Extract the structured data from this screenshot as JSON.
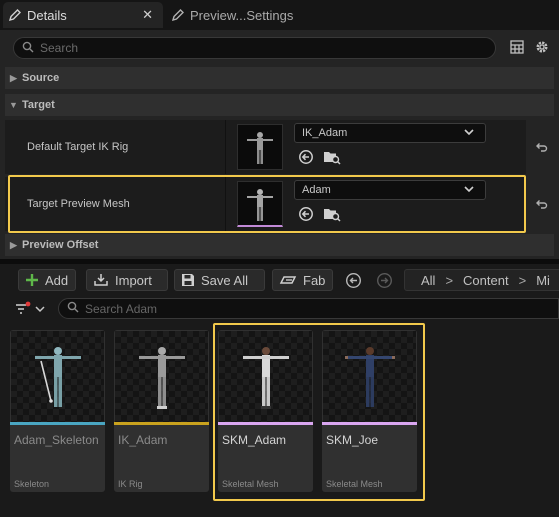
{
  "tabs": {
    "details_label": "Details",
    "preview_label": "Preview...Settings",
    "close_glyph": "✕"
  },
  "details": {
    "search_placeholder": "Search",
    "categories": {
      "source": "Source",
      "target": "Target",
      "preview_offset": "Preview Offset"
    },
    "properties": [
      {
        "label": "Default Target IK Rig",
        "value": "IK_Adam"
      },
      {
        "label": "Target Preview Mesh",
        "value": "Adam"
      }
    ]
  },
  "toolbar": {
    "add": "Add",
    "import": "Import",
    "save_all": "Save All",
    "fab": "Fab"
  },
  "breadcrumb": {
    "items": [
      "All",
      "Content",
      "Mi"
    ],
    "separator": ">"
  },
  "content_search_placeholder": "Search Adam",
  "assets": [
    {
      "name": "Adam_Skeleton",
      "type": "Skeleton",
      "strip_color": "#4aa6c2"
    },
    {
      "name": "IK_Adam",
      "type": "IK Rig",
      "strip_color": "#c9a21e"
    },
    {
      "name": "SKM_Adam",
      "type": "Skeletal Mesh",
      "strip_color": "#d9a6f0"
    },
    {
      "name": "SKM_Joe",
      "type": "Skeletal Mesh",
      "strip_color": "#d9a6f0"
    }
  ],
  "colors": {
    "highlight": "#f2c94c",
    "add_icon": "#5fb84a"
  }
}
